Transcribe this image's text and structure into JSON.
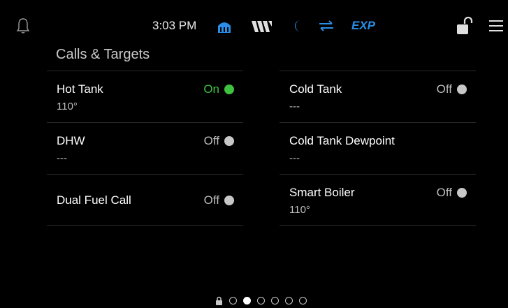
{
  "topbar": {
    "time": "3:03 PM",
    "exp_label": "EXP",
    "icons": [
      "bell-icon",
      "heat-icon",
      "w-logo-icon",
      "moon-icon",
      "swap-icon",
      "unlock-icon",
      "menu-icon"
    ],
    "accent_color": "#2a8ee8"
  },
  "section_title": "Calls & Targets",
  "left_rows": [
    {
      "label": "Hot Tank",
      "value": "110°",
      "status": "On"
    },
    {
      "label": "DHW",
      "value": "---",
      "status": "Off"
    },
    {
      "label": "Dual Fuel Call",
      "status": "Off"
    }
  ],
  "right_rows": [
    {
      "label": "Cold Tank",
      "value": "---",
      "status": "Off"
    },
    {
      "label": "Cold Tank Dewpoint",
      "value": "---"
    },
    {
      "label": "Smart Boiler",
      "value": "110°",
      "status": "Off"
    }
  ],
  "colors": {
    "on": "#3fc23f",
    "off": "#c8c8c8"
  },
  "pager": {
    "pages": 6,
    "active_page": 2
  }
}
